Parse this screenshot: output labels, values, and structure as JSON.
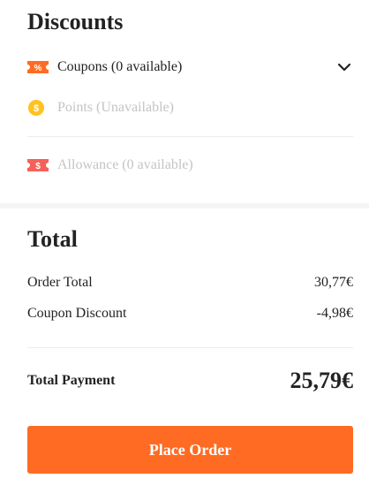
{
  "discounts": {
    "title": "Discounts",
    "coupons": {
      "label": "Coupons (0 available)",
      "icon": "coupon-percent-icon",
      "icon_color": "#ff6b22"
    },
    "points": {
      "label": "Points (Unavailable)",
      "icon": "points-coin-icon",
      "icon_color": "#ffc21f"
    },
    "allowance": {
      "label": "Allowance (0 available)",
      "icon": "allowance-dollar-icon",
      "icon_color": "#f5615a"
    }
  },
  "total": {
    "title": "Total",
    "order_total_label": "Order Total",
    "order_total_value": "30,77€",
    "coupon_discount_label": "Coupon Discount",
    "coupon_discount_value": "-4,98€",
    "total_payment_label": "Total Payment",
    "total_payment_value": "25,79€"
  },
  "actions": {
    "place_order_label": "Place Order",
    "accent_color": "#ff6b22"
  }
}
